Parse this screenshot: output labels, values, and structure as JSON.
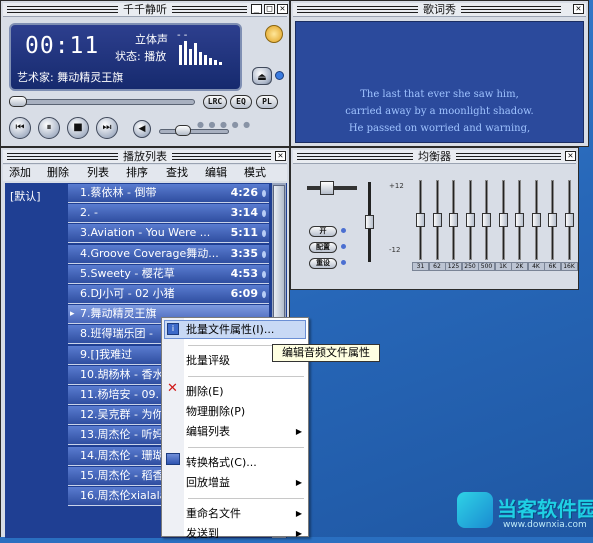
{
  "player": {
    "title": "千千静听",
    "time": "00:11",
    "channel": "立体声",
    "channel_dash": "- -",
    "status": "状态: 播放",
    "artist": "艺术家: 舞动精灵王旗",
    "buttons": {
      "lrc": "LRC",
      "eq": "EQ",
      "pl": "PL"
    }
  },
  "lyrics": {
    "title": "歌词秀",
    "lines": [
      "The last that ever she saw him,",
      "carried away by a moonlight shadow.",
      "He passed on worried and warning,"
    ]
  },
  "playlist": {
    "title": "播放列表",
    "menu": [
      "添加",
      "删除",
      "列表",
      "排序",
      "查找",
      "编辑",
      "模式"
    ],
    "list_name": "[默认]",
    "items": [
      {
        "title": "1.蔡依林 - 倒带",
        "dur": "4:26"
      },
      {
        "title": "2. -",
        "dur": "3:14"
      },
      {
        "title": "3.Aviation - You Were ...",
        "dur": "5:11"
      },
      {
        "title": "4.Groove Coverage舞动...",
        "dur": "3:35"
      },
      {
        "title": "5.Sweety - 樱花草",
        "dur": "4:53"
      },
      {
        "title": "6.DJ小可 - 02 小猪",
        "dur": "6:09"
      },
      {
        "title": "7.舞动精灵王旗",
        "dur": ""
      },
      {
        "title": "8.班得瑞乐团 -",
        "dur": ""
      },
      {
        "title": "9.[]我难过",
        "dur": ""
      },
      {
        "title": "10.胡杨林 - 香水",
        "dur": ""
      },
      {
        "title": "11.杨培安 - 09.",
        "dur": ""
      },
      {
        "title": "12.吴克群 - 为你",
        "dur": ""
      },
      {
        "title": "13.周杰伦 - 听妈",
        "dur": ""
      },
      {
        "title": "14.周杰伦 - 珊瑚",
        "dur": ""
      },
      {
        "title": "15.周杰伦 - 稻香",
        "dur": ""
      },
      {
        "title": "16.周杰伦xialala",
        "dur": ""
      }
    ]
  },
  "equalizer": {
    "title": "均衡器",
    "on": "开",
    "preset": "配置",
    "reset": "重设",
    "scale_top": "+12",
    "scale_bottom": "-12",
    "bands": [
      "31",
      "62",
      "125",
      "250",
      "500",
      "1K",
      "2K",
      "4K",
      "6K",
      "16K"
    ],
    "levels": [
      0,
      0,
      0,
      0,
      0,
      0,
      0,
      0,
      0,
      0
    ]
  },
  "context_menu": {
    "items": [
      {
        "label": "批量文件属性(I)...",
        "arrow": false,
        "sep_before": false
      },
      {
        "label": "批量评级",
        "arrow": false,
        "sep_before": true
      },
      {
        "label": "删除(E)",
        "arrow": false,
        "sep_before": true
      },
      {
        "label": "物理删除(P)",
        "arrow": false,
        "sep_before": false
      },
      {
        "label": "编辑列表",
        "arrow": true,
        "sep_before": false
      },
      {
        "label": "转换格式(C)...",
        "arrow": false,
        "sep_before": true
      },
      {
        "label": "回放增益",
        "arrow": true,
        "sep_before": false
      },
      {
        "label": "重命名文件",
        "arrow": true,
        "sep_before": true
      },
      {
        "label": "发送到",
        "arrow": true,
        "sep_before": false
      }
    ],
    "tooltip": "编辑音频文件属性"
  },
  "watermark": {
    "brand": "当客软件园",
    "url": "www.downxia.com"
  },
  "colors": {
    "accent": "#2f4ea0",
    "lyrics_text": "#9fc3ff",
    "desktop": "#2a6fc0"
  }
}
